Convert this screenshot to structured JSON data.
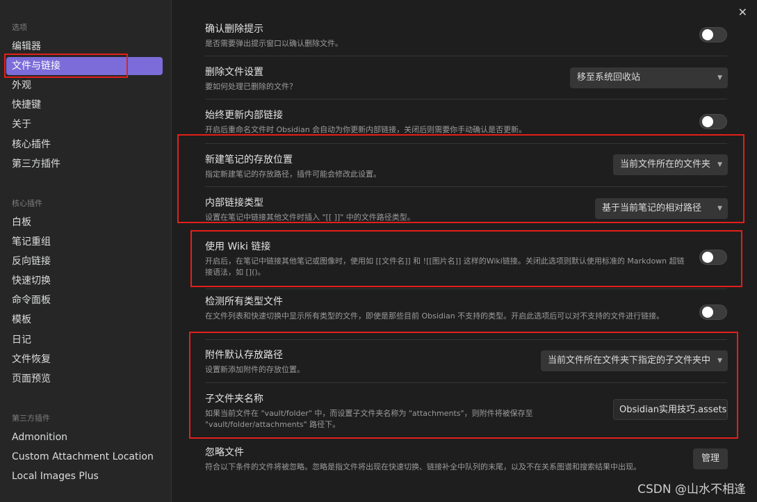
{
  "sidebar": {
    "options_heading": "选项",
    "options": [
      "编辑器",
      "文件与链接",
      "外观",
      "快捷键",
      "关于",
      "核心插件",
      "第三方插件"
    ],
    "core_heading": "核心插件",
    "core_plugins": [
      "白板",
      "笔记重组",
      "反向链接",
      "快速切换",
      "命令面板",
      "模板",
      "日记",
      "文件恢复",
      "页面预览"
    ],
    "third_heading": "第三方插件",
    "third_plugins": [
      "Admonition",
      "Custom Attachment Location",
      "Local Images Plus"
    ]
  },
  "close_label": "✕",
  "settings": [
    {
      "title": "确认删除提示",
      "desc": "是否需要弹出提示窗口以确认删除文件。",
      "control": "toggle"
    },
    {
      "title": "删除文件设置",
      "desc": "要如何处理已删除的文件？",
      "control": "select",
      "value": "移至系统回收站"
    },
    {
      "title": "始终更新内部链接",
      "desc": "开启后重命名文件时 Obsidian 会自动为你更新内部链接，关闭后则需要你手动确认是否更新。",
      "control": "toggle"
    },
    {
      "title": "新建笔记的存放位置",
      "desc": "指定新建笔记的存放路径，插件可能会修改此设置。",
      "control": "select",
      "value": "当前文件所在的文件夹"
    },
    {
      "title": "内部链接类型",
      "desc": "设置在笔记中链接其他文件时插入 \"[[ ]]\" 中的文件路径类型。",
      "control": "select",
      "value": "基于当前笔记的相对路径"
    },
    {
      "title": "使用 Wiki 链接",
      "desc": "开启后，在笔记中链接其他笔记或图像时，使用如 [[文件名]] 和 ![[图片名]] 这样的Wiki链接。关闭此选项则默认使用标准的 Markdown 超链接语法，如 []()。",
      "control": "toggle"
    },
    {
      "title": "检测所有类型文件",
      "desc": "在文件列表和快速切换中显示所有类型的文件，即使是那些目前 Obsidian 不支持的类型。开启此选项后可以对不支持的文件进行链接。",
      "control": "toggle"
    },
    {
      "title": "附件默认存放路径",
      "desc": "设置新添加附件的存放位置。",
      "control": "select",
      "value": "当前文件所在文件夹下指定的子文件夹中"
    },
    {
      "title": "子文件夹名称",
      "desc": "如果当前文件在 \"vault/folder\" 中，而设置子文件夹名称为 \"attachments\"，则附件将被保存至 \"vault/folder/attachments\" 路径下。",
      "control": "text",
      "value": "Obsidian实用技巧.assets"
    },
    {
      "title": "忽略文件",
      "desc": "符合以下条件的文件将被忽略。忽略是指文件将出现在快速切换、链接补全中队列的末尾，以及不在关系图谱和搜索结果中出现。",
      "control": "button",
      "value": "管理"
    }
  ],
  "watermark": "CSDN @山水不相逢"
}
